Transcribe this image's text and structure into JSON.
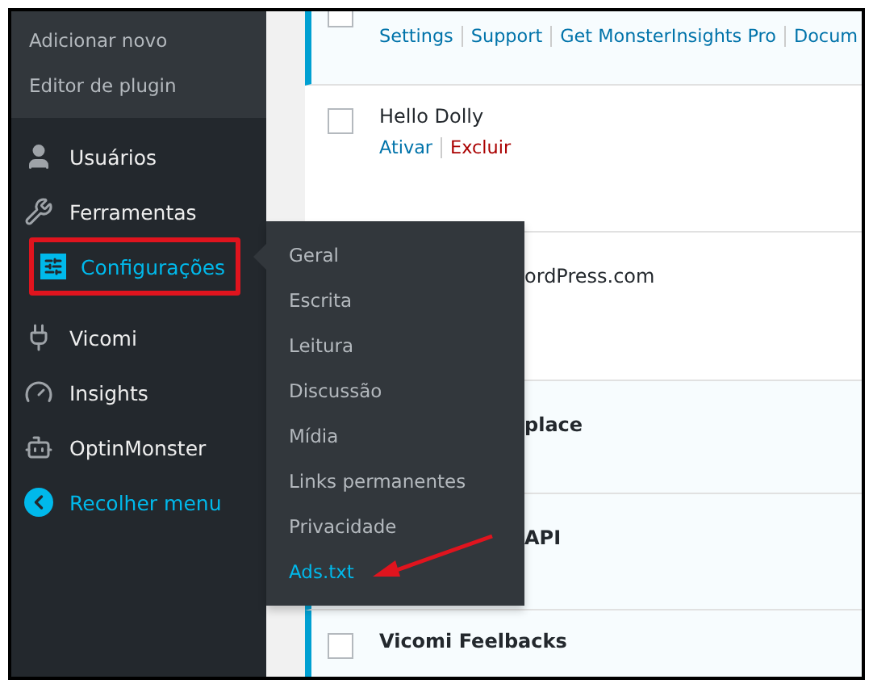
{
  "sidebar": {
    "submenu": [
      {
        "label": "Adicionar novo"
      },
      {
        "label": "Editor de plugin"
      }
    ],
    "items": [
      {
        "label": "Usuários",
        "kind": "menu",
        "current": false
      },
      {
        "label": "Ferramentas",
        "kind": "menu",
        "current": false
      },
      {
        "label": "Configurações",
        "kind": "menu",
        "current": true,
        "highlighted": true
      },
      {
        "label": "Vicomi",
        "kind": "menu",
        "current": false
      },
      {
        "label": "Insights",
        "kind": "menu",
        "current": false
      },
      {
        "label": "OptinMonster",
        "kind": "menu",
        "current": false
      },
      {
        "label": "Recolher menu",
        "kind": "collapse",
        "current": false
      }
    ]
  },
  "flyout": {
    "items": [
      {
        "label": "Geral",
        "selected": false
      },
      {
        "label": "Escrita",
        "selected": false
      },
      {
        "label": "Leitura",
        "selected": false
      },
      {
        "label": "Discussão",
        "selected": false
      },
      {
        "label": "Mídia",
        "selected": false
      },
      {
        "label": "Links permanentes",
        "selected": false
      },
      {
        "label": "Privacidade",
        "selected": false
      },
      {
        "label": "Ads.txt",
        "selected": true
      }
    ]
  },
  "plugins": [
    {
      "kind": "cut",
      "active": true,
      "actions": [
        {
          "label": "Settings",
          "kind": "link"
        },
        {
          "label": "Support",
          "kind": "link"
        },
        {
          "label": "Get MonsterInsights Pro",
          "kind": "link"
        },
        {
          "label": "Docum",
          "kind": "link"
        }
      ]
    },
    {
      "kind": "full",
      "name": "Hello Dolly",
      "active": false,
      "actions": [
        {
          "label": "Ativar",
          "kind": "link"
        },
        {
          "label": "Excluir",
          "kind": "delete"
        }
      ]
    },
    {
      "kind": "covered",
      "name": "ordPress.com",
      "active": false
    },
    {
      "kind": "covered",
      "name": "place",
      "active": true
    },
    {
      "kind": "covered",
      "name": "API",
      "active": true
    },
    {
      "kind": "full",
      "name": "Vicomi Feelbacks",
      "active": true
    }
  ]
}
